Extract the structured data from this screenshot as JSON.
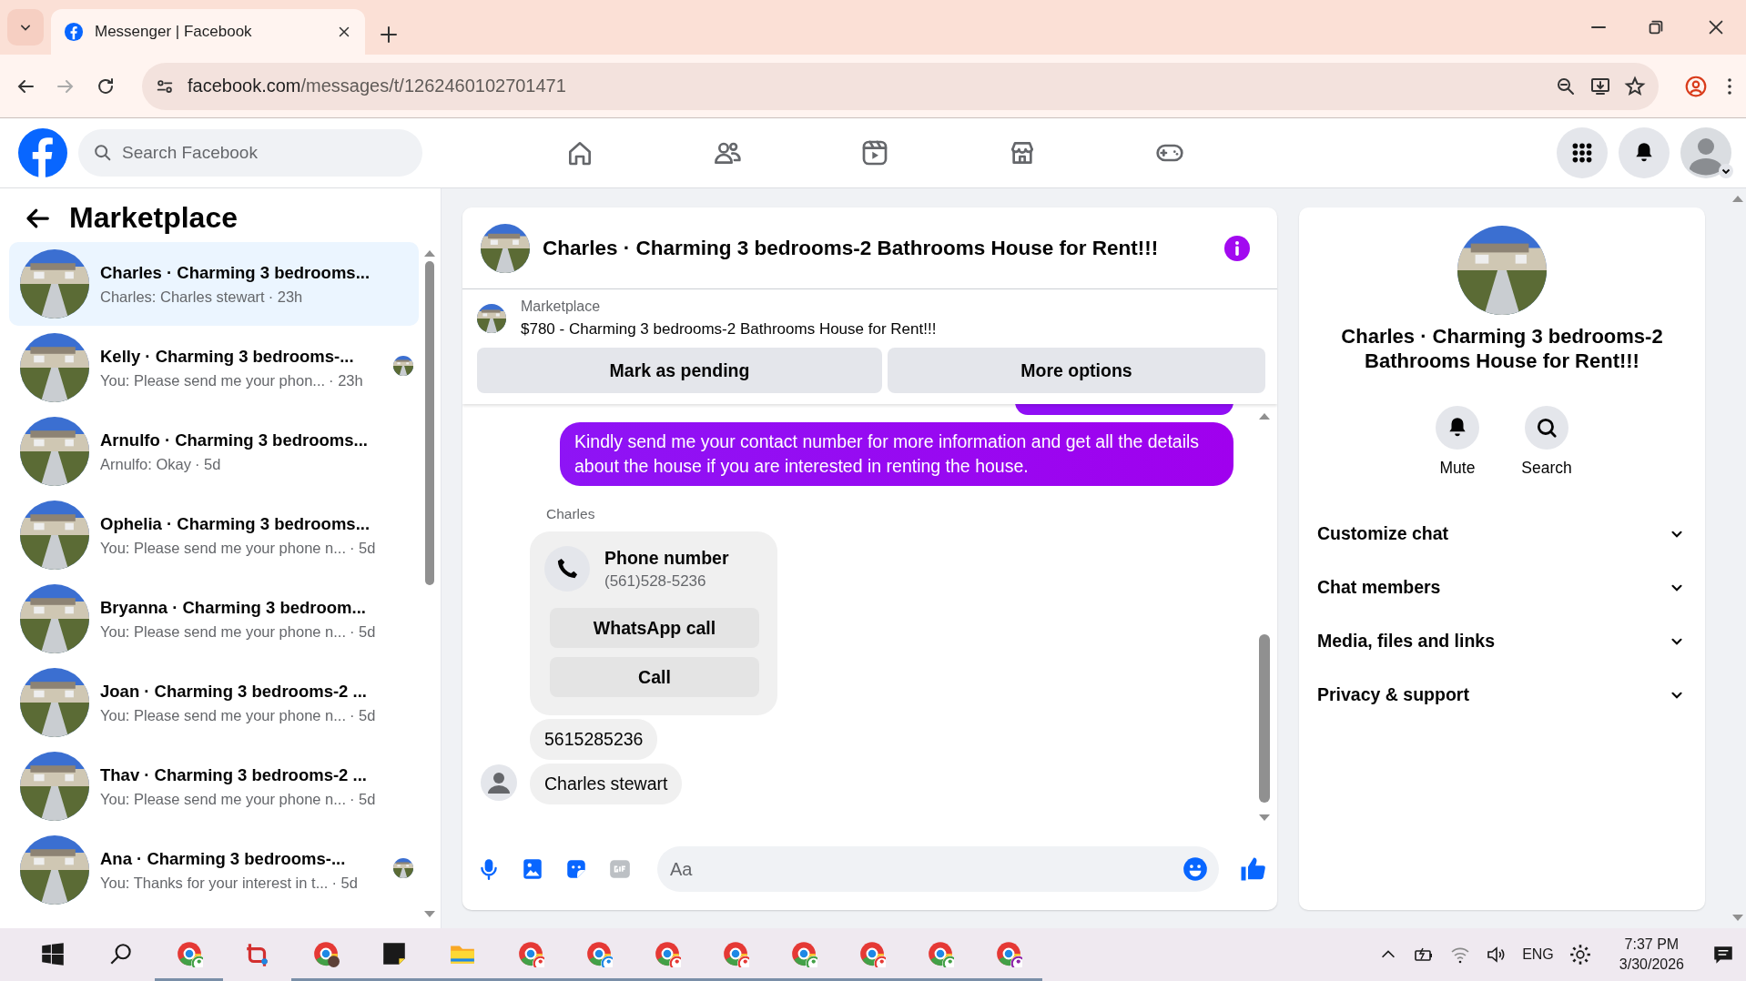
{
  "browser": {
    "tab_title": "Messenger | Facebook",
    "url_domain": "facebook.com",
    "url_path": "/messages/t/1262460102701471"
  },
  "header": {
    "search_placeholder": "Search Facebook"
  },
  "sidebar": {
    "title": "Marketplace",
    "conversations": [
      {
        "title": "Charles · Charming 3 bedrooms...",
        "preview": "Charles: Charles stewart",
        "time": "· 23h",
        "selected": true,
        "seen": false
      },
      {
        "title": "Kelly · Charming 3 bedrooms-...",
        "preview": "You: Please send me your phon...",
        "time": "· 23h",
        "selected": false,
        "seen": true
      },
      {
        "title": "Arnulfo · Charming 3 bedrooms...",
        "preview": "Arnulfo: Okay",
        "time": "· 5d",
        "selected": false,
        "seen": false
      },
      {
        "title": "Ophelia · Charming 3 bedrooms...",
        "preview": "You: Please send me your phone n...",
        "time": "· 5d",
        "selected": false,
        "seen": false
      },
      {
        "title": "Bryanna · Charming 3 bedroom...",
        "preview": "You: Please send me your phone n...",
        "time": "· 5d",
        "selected": false,
        "seen": false
      },
      {
        "title": "Joan · Charming 3 bedrooms-2 ...",
        "preview": "You: Please send me your phone n...",
        "time": "· 5d",
        "selected": false,
        "seen": false
      },
      {
        "title": "Thav · Charming 3 bedrooms-2 ...",
        "preview": "You: Please send me your phone n...",
        "time": "· 5d",
        "selected": false,
        "seen": false
      },
      {
        "title": "Ana · Charming 3 bedrooms-...",
        "preview": "You: Thanks for your interest in t...",
        "time": "· 5d",
        "selected": false,
        "seen": true
      }
    ]
  },
  "chat": {
    "title": "Charles · Charming 3 bedrooms-2 Bathrooms House for Rent!!!",
    "listing": {
      "source": "Marketplace",
      "text": "$780 - Charming 3 bedrooms-2 Bathrooms House for Rent!!!"
    },
    "actions": [
      "Mark as pending",
      "More options"
    ],
    "messages": [
      {
        "kind": "outgoing",
        "text": "Kindly send me your contact number for more information and get all the details about the house if you are interested in renting the house."
      },
      {
        "kind": "sender_name",
        "text": "Charles"
      },
      {
        "kind": "contact_card",
        "title": "Phone number",
        "number": "(561)528-5236",
        "buttons": [
          "WhatsApp call",
          "Call"
        ]
      },
      {
        "kind": "incoming",
        "text": "5615285236",
        "avatar": false
      },
      {
        "kind": "incoming",
        "text": "Charles stewart",
        "avatar": true
      }
    ],
    "composer": {
      "placeholder": "Aa"
    }
  },
  "info": {
    "title": "Charles · Charming 3 bedrooms-2 Bathrooms House for Rent!!!",
    "actions": [
      {
        "kind": "mute",
        "label": "Mute"
      },
      {
        "kind": "search",
        "label": "Search"
      }
    ],
    "sections": [
      "Customize chat",
      "Chat members",
      "Media, files and links",
      "Privacy & support"
    ]
  },
  "taskbar": {
    "language": "ENG",
    "time": "7:37 PM",
    "date": "3/30/2026"
  }
}
